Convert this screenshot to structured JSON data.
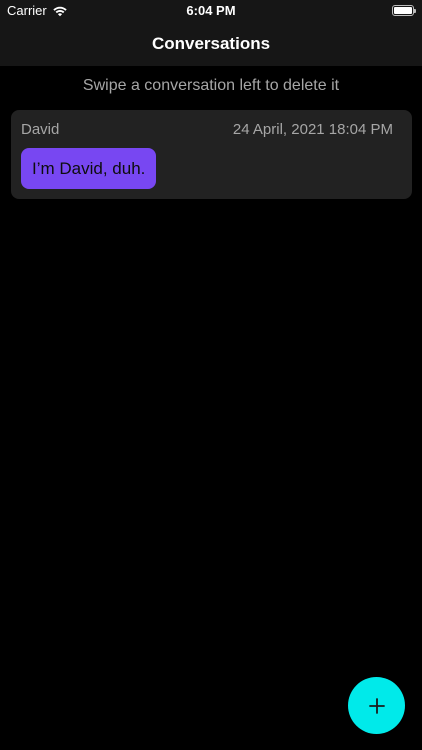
{
  "status_bar": {
    "carrier": "Carrier",
    "time": "6:04 PM"
  },
  "nav": {
    "title": "Conversations"
  },
  "hint": "Swipe a conversation left to delete it",
  "conversations": [
    {
      "name": "David",
      "date": "24 April, 2021 18:04 PM",
      "message": "I’m David, duh."
    }
  ],
  "icons": {
    "wifi": "wifi-icon",
    "battery": "battery-icon",
    "add": "plus-icon"
  },
  "colors": {
    "background": "#000000",
    "bar": "#161616",
    "card": "#222222",
    "bubble": "#7847f2",
    "fab": "#00eaea",
    "muted_text": "#a6a6a6"
  }
}
